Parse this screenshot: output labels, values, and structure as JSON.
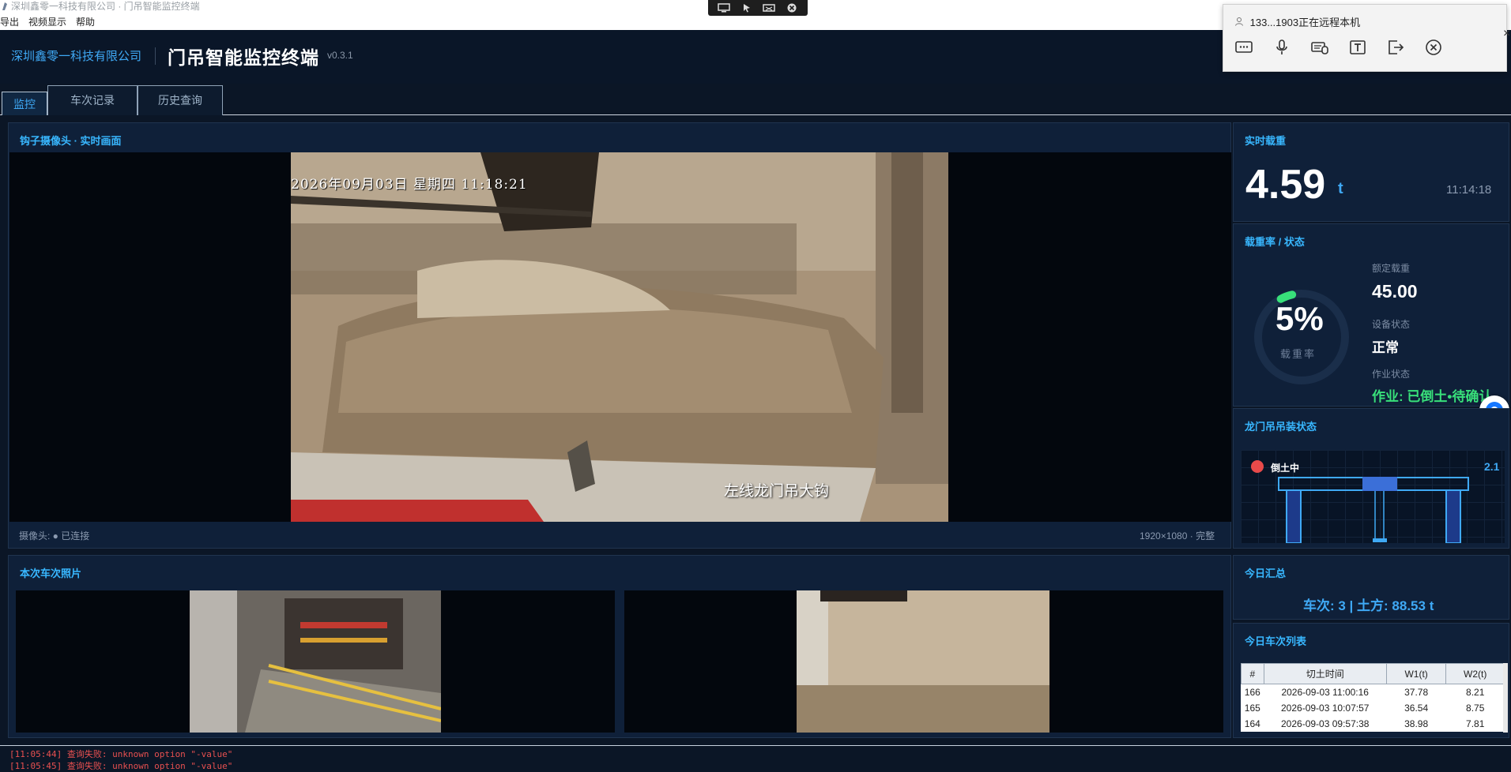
{
  "window": {
    "title": "深圳鑫零一科技有限公司 · 门吊智能监控终端",
    "menu": [
      "导出",
      "视频显示",
      "帮助"
    ]
  },
  "remote": {
    "status": "133...1903正在远程本机",
    "toolbar_icons": [
      "monitor-icon",
      "pointer-icon",
      "keyboard-icon",
      "close-icon"
    ],
    "popup_icons": [
      "chat-icon",
      "microphone-icon",
      "keyboard-mouse-icon",
      "text-icon",
      "exit-icon",
      "close-icon"
    ]
  },
  "header": {
    "company": "深圳鑫零一科技有限公司",
    "title": "门吊智能监控终端",
    "version": "v0.3.1"
  },
  "tabs": [
    {
      "label": "监控",
      "active": true
    },
    {
      "label": "车次记录",
      "active": false
    },
    {
      "label": "历史查询",
      "active": false
    }
  ],
  "camera": {
    "title": "钩子摄像头 · 实时画面",
    "timestamp": "2026年09月03日 星期四 11:18:21",
    "overlay_label": "左线龙门吊大钩",
    "status": "摄像头: ● 已连接",
    "resolution": "1920×1080 · 完整"
  },
  "weight": {
    "title": "实时载重",
    "value": "4.59",
    "unit": "t",
    "time": "11:14:18"
  },
  "load": {
    "title": "载重率 / 状态",
    "percent_text": "5%",
    "percent": 5,
    "percent_label": "载重率",
    "rated_label": "额定载重",
    "rated_value": "45.00",
    "device_label": "设备状态",
    "device_value": "正常",
    "work_label": "作业状态",
    "work_value": "作业: 已倒土•待确认"
  },
  "gantry": {
    "title": "龙门吊吊装状态",
    "status": "倒土中",
    "value": "2.1"
  },
  "photos": {
    "title": "本次车次照片"
  },
  "summary": {
    "title": "今日汇总",
    "text": "车次: 3 | 土方: 88.53 t"
  },
  "trips": {
    "title": "今日车次列表",
    "columns": [
      "#",
      "切土时间",
      "W1(t)",
      "W2(t)"
    ],
    "rows": [
      [
        "166",
        "2026-09-03 11:00:16",
        "37.78",
        "8.21"
      ],
      [
        "165",
        "2026-09-03 10:07:57",
        "36.54",
        "8.75"
      ],
      [
        "164",
        "2026-09-03 09:57:38",
        "38.98",
        "7.81"
      ]
    ]
  },
  "log": [
    "[11:05:44] 查询失败: unknown option \"-value\"",
    "[11:05:45] 查询失败: unknown option \"-value\""
  ],
  "colors": {
    "accent": "#38b7ff",
    "ok": "#38e07a",
    "alert": "#e84a4a",
    "background": "#0b1626"
  }
}
